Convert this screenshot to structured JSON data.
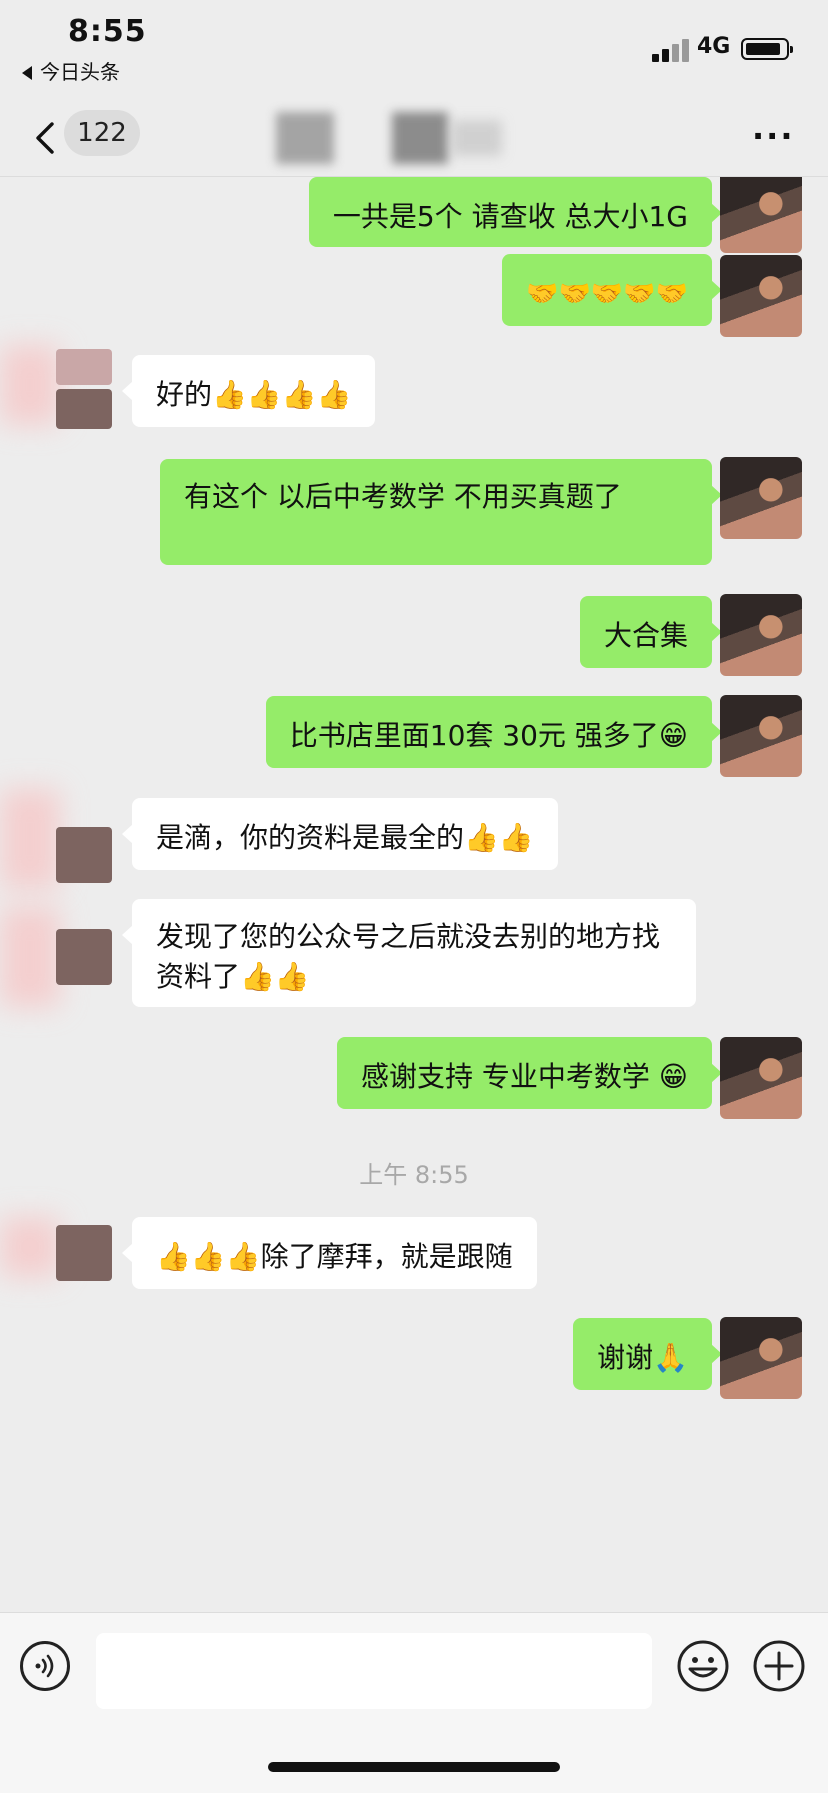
{
  "status_bar": {
    "time": "8:55",
    "back_app": "今日头条",
    "network": "4G"
  },
  "nav": {
    "unread_count": "122",
    "more": "···"
  },
  "messages": [
    {
      "side": "me",
      "text": "一共是5个 请查收  总大小1G"
    },
    {
      "side": "me",
      "text": "🤝🤝🤝🤝🤝"
    },
    {
      "side": "them",
      "text": "好的👍👍👍👍"
    },
    {
      "side": "me",
      "text": "有这个 以后中考数学 不用买真题了"
    },
    {
      "side": "me",
      "text": "大合集"
    },
    {
      "side": "me",
      "text": "比书店里面10套 30元 强多了😁"
    },
    {
      "side": "them",
      "text": "是滴，你的资料是最全的👍👍"
    },
    {
      "side": "them",
      "text": "发现了您的公众号之后就没去别的地方找资料了👍👍"
    },
    {
      "side": "me",
      "text": "感谢支持  专业中考数学 😁"
    },
    {
      "side": "them",
      "text": "👍👍👍除了摩拜，就是跟随"
    },
    {
      "side": "me",
      "text": "谢谢🙏"
    }
  ],
  "timestamp": "上午 8:55",
  "input_bar": {
    "voice_icon": "voice-icon",
    "emoji_icon": "emoji-icon",
    "plus_icon": "plus-icon"
  },
  "colors": {
    "me_bubble": "#95ec69",
    "them_bubble": "#ffffff",
    "background": "#ededed"
  }
}
